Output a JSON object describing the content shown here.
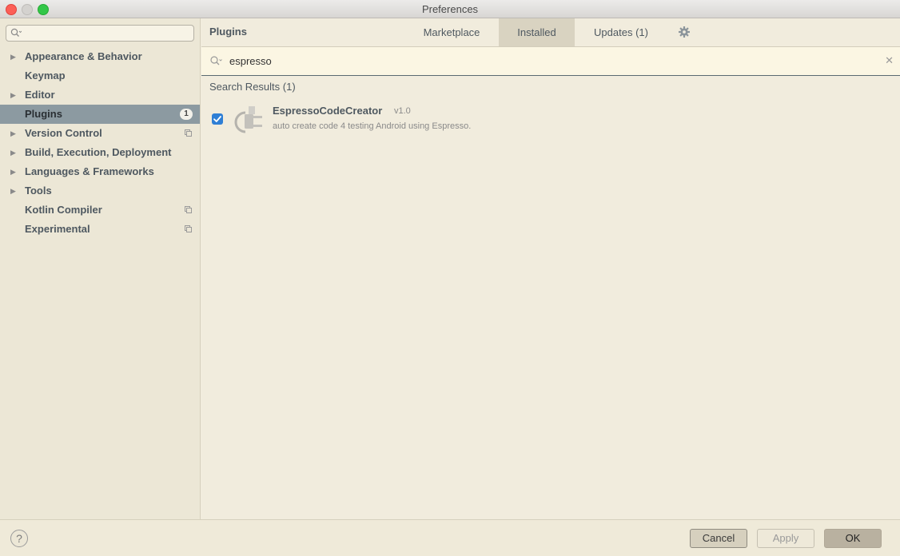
{
  "window": {
    "title": "Preferences"
  },
  "sidebar": {
    "search_placeholder": "",
    "items": [
      {
        "label": "Appearance & Behavior",
        "expandable": true
      },
      {
        "label": "Keymap",
        "expandable": false
      },
      {
        "label": "Editor",
        "expandable": true
      },
      {
        "label": "Plugins",
        "expandable": false,
        "selected": true,
        "badge": "1"
      },
      {
        "label": "Version Control",
        "expandable": true,
        "project_icon": true
      },
      {
        "label": "Build, Execution, Deployment",
        "expandable": true
      },
      {
        "label": "Languages & Frameworks",
        "expandable": true
      },
      {
        "label": "Tools",
        "expandable": true
      },
      {
        "label": "Kotlin Compiler",
        "expandable": false,
        "project_icon": true
      },
      {
        "label": "Experimental",
        "expandable": false,
        "project_icon": true
      }
    ]
  },
  "plugins": {
    "title": "Plugins",
    "tabs": {
      "marketplace": "Marketplace",
      "installed": "Installed",
      "updates": "Updates (1)"
    },
    "active_tab": "Installed",
    "search": {
      "value": "espresso"
    },
    "results_title": "Search Results (1)",
    "results": [
      {
        "name": "EspressoCodeCreator",
        "version": "v1.0",
        "description": "auto create code 4 testing Android using Espresso.",
        "enabled": true
      }
    ]
  },
  "footer": {
    "help": "?",
    "cancel": "Cancel",
    "apply": "Apply",
    "ok": "OK"
  },
  "colors": {
    "background": "#f1ecdd",
    "selection": "#8c9aa1",
    "checkbox": "#2f7fd5"
  }
}
